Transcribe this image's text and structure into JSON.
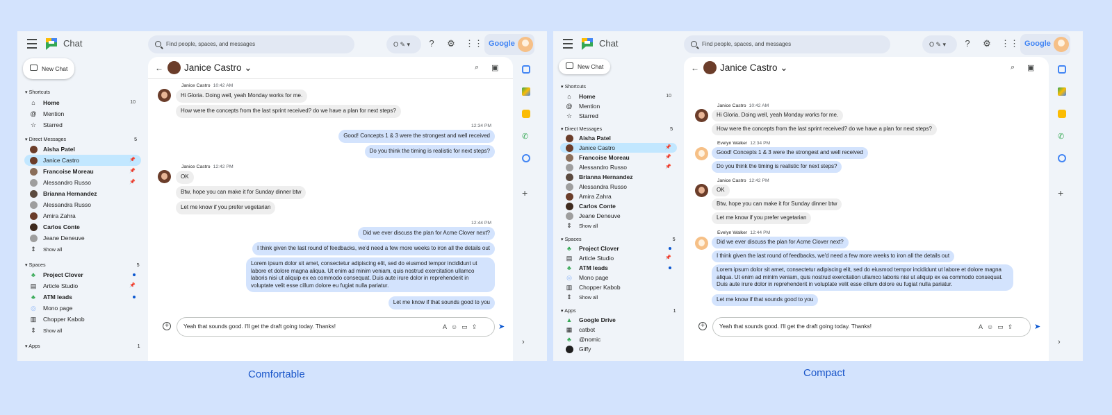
{
  "app": {
    "name": "Chat"
  },
  "search": {
    "placeholder": "Find people, spaces, and messages"
  },
  "status": {
    "label": "O ✎ ▾"
  },
  "google": {
    "label": "Google"
  },
  "new_chat": {
    "label": "New Chat"
  },
  "sections": {
    "shortcuts": "Shortcuts",
    "direct_messages": "Direct Messages",
    "spaces": "Spaces",
    "apps": "Apps",
    "show_all": "Show all"
  },
  "counts": {
    "home": "10",
    "dm": "5",
    "spaces": "5",
    "apps": "1"
  },
  "shortcuts": [
    "Home",
    "Mention",
    "Starred"
  ],
  "direct_messages": [
    "Aisha Patel",
    "Janice Castro",
    "Francoise Moreau",
    "Alessandro Russo",
    "Brianna Hernandez",
    "Alessandra Russo",
    "Amira Zahra",
    "Carlos Conte",
    "Jeane Deneuve"
  ],
  "spaces": [
    "Project Clover",
    "Article Studio",
    "ATM leads",
    "Mono page",
    "Chopper Kabob"
  ],
  "apps": [
    "Google Drive",
    "catbot",
    "@nomic",
    "Giffy"
  ],
  "chat": {
    "title": "Janice Castro",
    "sender_janice": "Janice Castro",
    "sender_evelyn": "Evelyn Walker",
    "t1": "10:42 AM",
    "t2": "12:34 PM",
    "t3": "12:42 PM",
    "t4": "12:44 PM",
    "messages": [
      "Hi Gloria. Doing well, yeah Monday works for me.",
      "How were the concepts from the last sprint received? do we have a plan for next steps?",
      "Good! Concepts 1 & 3 were the strongest and well received",
      "Do you think the timing is realistic for next steps?",
      "OK",
      "Btw, hope you can make it for Sunday dinner btw",
      "Let me know if you prefer vegetarian",
      "Did we ever discuss the plan for Acme Clover next?",
      "I think given the last round of feedbacks, we'd need a few more weeks to iron all the details out",
      "Lorem ipsum dolor sit amet, consectetur adipiscing elit, sed do eiusmod tempor incididunt ut labore et dolore magna aliqua. Ut enim ad minim veniam, quis nostrud exercitation ullamco laboris nisi ut aliquip ex ea commodo consequat. Duis aute irure dolor in reprehenderit in voluptate velit esse cillum dolore eu fugiat nulla pariatur.",
      "Let me know if that sounds good to you"
    ],
    "draft": "Yeah that sounds good. I'll get the draft going today. Thanks!"
  },
  "captions": {
    "left": "Comfortable",
    "right": "Compact"
  },
  "colors": {
    "background": "#d3e3fd",
    "accent": "#0b57d0",
    "selected": "#c2e7ff",
    "outgoing": "#d3e3fd"
  }
}
